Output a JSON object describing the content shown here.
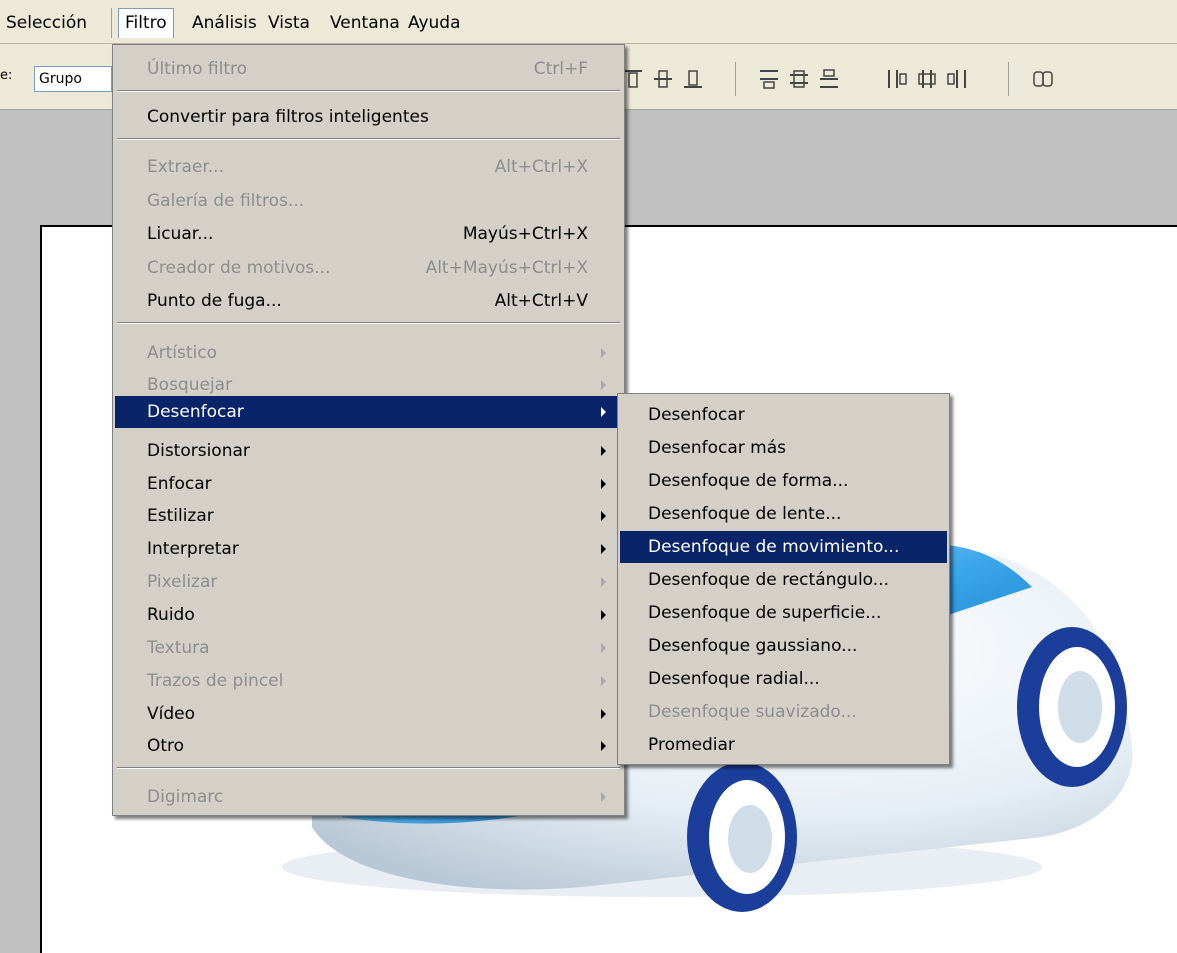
{
  "menubar": {
    "items": [
      {
        "label": "Selección"
      },
      {
        "label": "Filtro"
      },
      {
        "label": "Análisis"
      },
      {
        "label": "Vista"
      },
      {
        "label": "Ventana"
      },
      {
        "label": "Ayuda"
      }
    ]
  },
  "options": {
    "label": "e:",
    "select_value": "Grupo"
  },
  "filter_menu": {
    "last_filter": {
      "label": "Último filtro",
      "shortcut": "Ctrl+F"
    },
    "smart_filters": {
      "label": "Convertir para filtros inteligentes"
    },
    "extract": {
      "label": "Extraer...",
      "shortcut": "Alt+Ctrl+X"
    },
    "gallery": {
      "label": "Galería de filtros..."
    },
    "liquify": {
      "label": "Licuar...",
      "shortcut": "Mayús+Ctrl+X"
    },
    "pattern_maker": {
      "label": "Creador de motivos...",
      "shortcut": "Alt+Mayús+Ctrl+X"
    },
    "vanishing_point": {
      "label": "Punto de fuga...",
      "shortcut": "Alt+Ctrl+V"
    },
    "submenus": [
      {
        "label": "Artístico"
      },
      {
        "label": "Bosquejar"
      },
      {
        "label": "Desenfocar"
      },
      {
        "label": "Distorsionar"
      },
      {
        "label": "Enfocar"
      },
      {
        "label": "Estilizar"
      },
      {
        "label": "Interpretar"
      },
      {
        "label": "Pixelizar"
      },
      {
        "label": "Ruido"
      },
      {
        "label": "Textura"
      },
      {
        "label": "Trazos de pincel"
      },
      {
        "label": "Vídeo"
      },
      {
        "label": "Otro"
      }
    ],
    "digimarc": {
      "label": "Digimarc"
    }
  },
  "blur_menu": {
    "items": [
      {
        "label": "Desenfocar"
      },
      {
        "label": "Desenfocar más"
      },
      {
        "label": "Desenfoque de forma..."
      },
      {
        "label": "Desenfoque de lente..."
      },
      {
        "label": "Desenfoque de movimiento..."
      },
      {
        "label": "Desenfoque de rectángulo..."
      },
      {
        "label": "Desenfoque de superficie..."
      },
      {
        "label": "Desenfoque gaussiano..."
      },
      {
        "label": "Desenfoque radial..."
      },
      {
        "label": "Desenfoque suavizado..."
      },
      {
        "label": "Promediar"
      }
    ]
  },
  "colors": {
    "highlight": "#0a246a",
    "menu_bg": "#d4d0c8",
    "disabled_text": "#8d8d8d",
    "canvas_bg": "#c0c0c0"
  }
}
